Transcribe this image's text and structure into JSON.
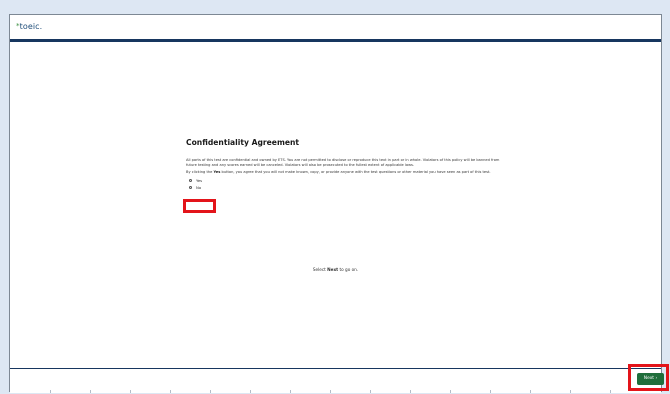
{
  "header": {
    "logo_star": "*",
    "logo_text": "toeic."
  },
  "agreement": {
    "title": "Confidentiality Agreement",
    "paragraph1": "All parts of this test are confidential and owned by ETS. You are not permitted to disclose or reproduce this text in part or in whole. Violators of this policy will be banned from future testing and any scores earned will be canceled. Violators will also be prosecuted to the fullest extent of applicable laws.",
    "paragraph2_before": "By clicking the ",
    "paragraph2_bold": "Yes",
    "paragraph2_after": " button, you agree that you will not make known, copy, or provide anyone with the test questions or other material you have seen as part of this test.",
    "option_yes": "Yes",
    "option_no": "No"
  },
  "prompt": {
    "before": "Select ",
    "bold": "Next",
    "after": " to go on."
  },
  "footer": {
    "next_label": "Next",
    "next_chevron": "›"
  },
  "colors": {
    "header_bar": "#17365f",
    "next_button": "#1f6e3b",
    "highlight": "#e3141a",
    "logo_text": "#1f4e7a",
    "logo_star": "#3a8f3f"
  }
}
